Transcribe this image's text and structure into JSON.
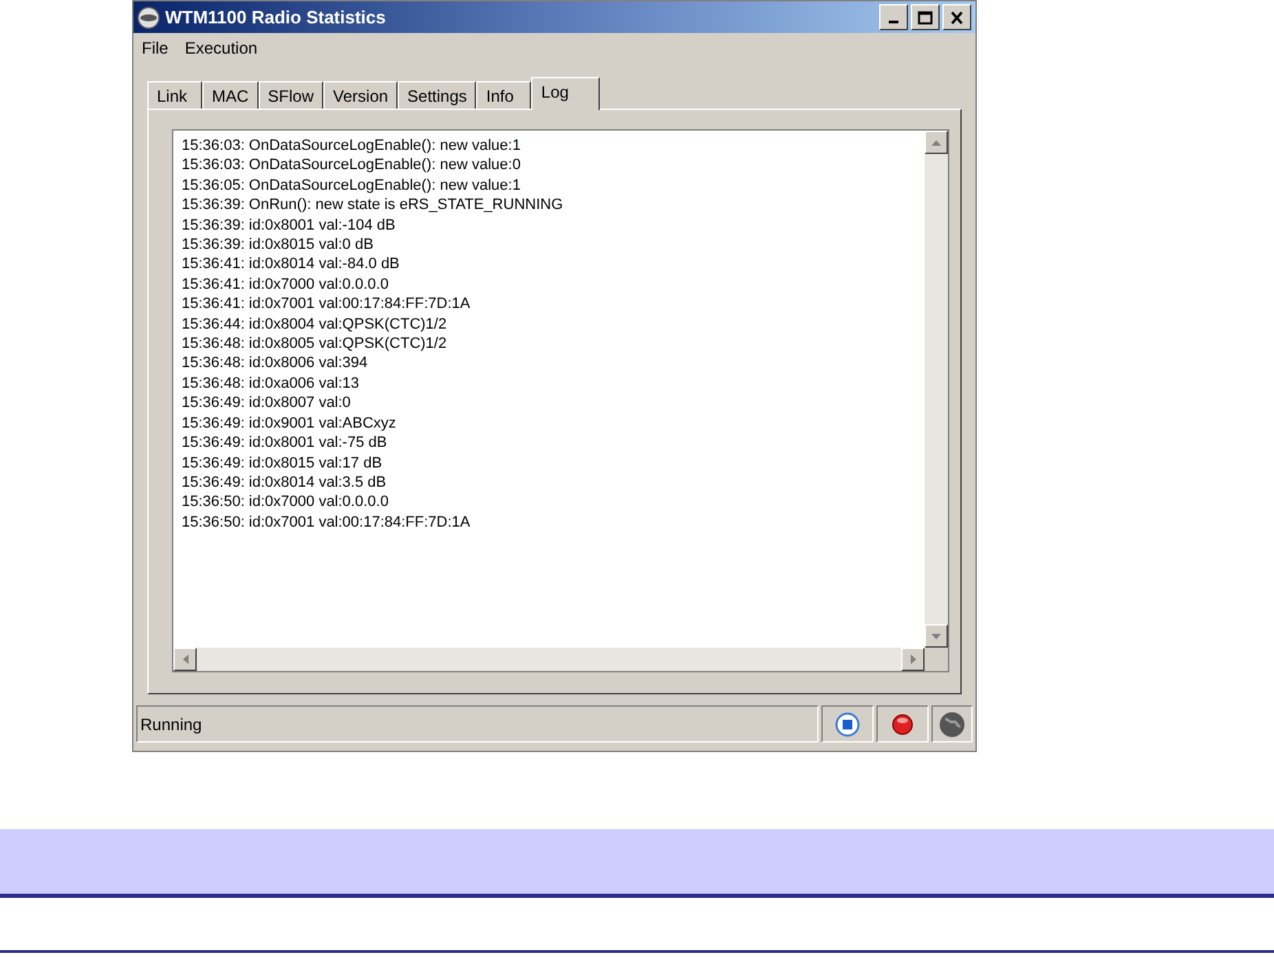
{
  "window": {
    "title": "WTM1100 Radio Statistics"
  },
  "menu": [
    "File",
    "Execution"
  ],
  "tabs": [
    {
      "label": "Link",
      "selected": false
    },
    {
      "label": "MAC",
      "selected": false
    },
    {
      "label": "SFlow",
      "selected": false
    },
    {
      "label": "Version",
      "selected": false
    },
    {
      "label": "Settings",
      "selected": false
    },
    {
      "label": "Info",
      "selected": false
    },
    {
      "label": "Log",
      "selected": true
    }
  ],
  "log": [
    "15:36:03: OnDataSourceLogEnable(): new value:1",
    "15:36:03: OnDataSourceLogEnable(): new value:0",
    "15:36:05: OnDataSourceLogEnable(): new value:1",
    "15:36:39: OnRun(): new state is eRS_STATE_RUNNING",
    "15:36:39: id:0x8001 val:-104 dB",
    "15:36:39: id:0x8015 val:0 dB",
    "15:36:41: id:0x8014 val:-84.0 dB",
    "15:36:41: id:0x7000 val:0.0.0.0",
    "15:36:41: id:0x7001 val:00:17:84:FF:7D:1A",
    "15:36:44: id:0x8004 val:QPSK(CTC)1/2",
    "15:36:48: id:0x8005 val:QPSK(CTC)1/2",
    "15:36:48: id:0x8006 val:394",
    "15:36:48: id:0xa006 val:13",
    "15:36:49: id:0x8007 val:0",
    "15:36:49: id:0x9001 val:ABCxyz",
    "15:36:49: id:0x8001 val:-75 dB",
    "15:36:49: id:0x8015 val:17 dB",
    "15:36:49: id:0x8014 val:3.5 dB",
    "15:36:50: id:0x7000 val:0.0.0.0",
    "15:36:50: id:0x7001 val:00:17:84:FF:7D:1A"
  ],
  "status_bar": {
    "text": "Running"
  }
}
